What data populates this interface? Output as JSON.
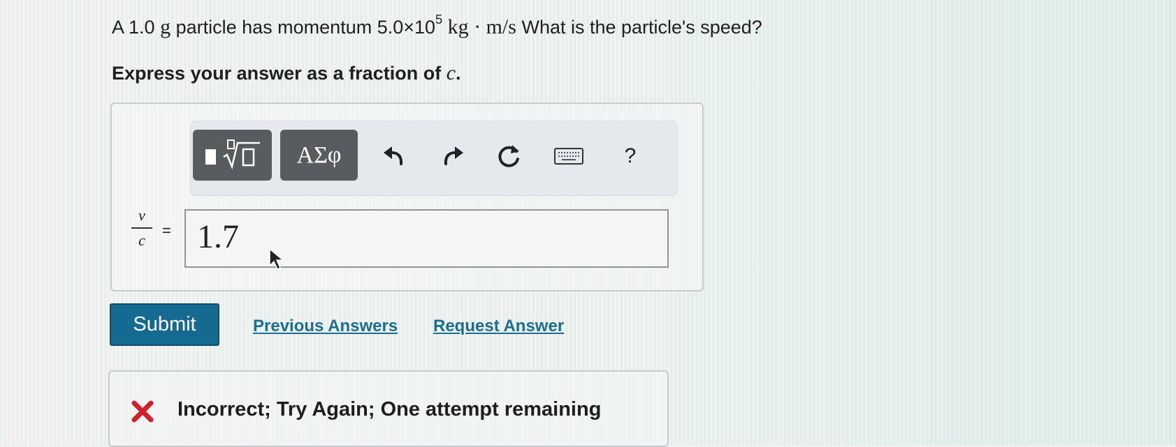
{
  "prompt": {
    "lead": "A 1.0",
    "unit_g": "g",
    "middle": "particle has momentum",
    "momentum_mantissa": "5.0×10",
    "momentum_exponent": "5",
    "momentum_units": "kg · m/s",
    "question": "What is the particle's speed?"
  },
  "instructions": {
    "text": "Express your answer as a fraction of",
    "variable": "c",
    "period": "."
  },
  "toolbar": {
    "symbols_label": "ΑΣφ",
    "help_label": "?",
    "icons": [
      "templates-icon",
      "undo-icon",
      "redo-icon",
      "reset-icon",
      "keyboard-icon",
      "help-icon"
    ]
  },
  "answer": {
    "numerator": "v",
    "denominator": "c",
    "equals": "=",
    "value": "1.7"
  },
  "actions": {
    "submit_label": "Submit",
    "previous_answers_label": "Previous Answers",
    "request_answer_label": "Request Answer"
  },
  "feedback": {
    "text": "Incorrect; Try Again; One attempt remaining",
    "icon": "x-icon",
    "status_color": "#d0202a"
  },
  "colors": {
    "submit_bg": "#146a91",
    "link": "#1b6e8e",
    "toolbar_dark": "#595c5f"
  }
}
